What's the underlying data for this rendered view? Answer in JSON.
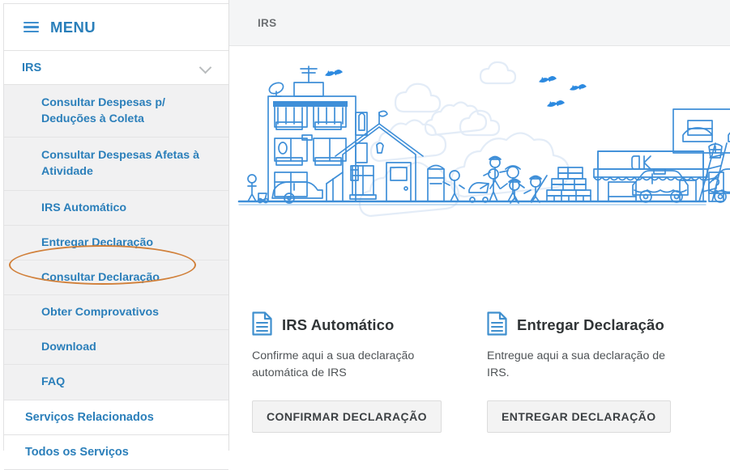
{
  "sidebar": {
    "menu_icon": "hamburger-icon",
    "menu_label": "MENU",
    "group": {
      "label": "IRS",
      "chevron": "chevron-down-icon"
    },
    "submenu": [
      {
        "label": "Consultar Despesas p/ Deduções à Coleta",
        "two_line": true
      },
      {
        "label": "Consultar Despesas Afetas à Atividade",
        "two_line": true
      },
      {
        "label": "IRS Automático",
        "two_line": false
      },
      {
        "label": "Entregar Declaração",
        "two_line": false
      },
      {
        "label": "Consultar Declaração",
        "two_line": false,
        "highlighted": true
      },
      {
        "label": "Obter Comprovativos",
        "two_line": false
      },
      {
        "label": "Download",
        "two_line": false
      },
      {
        "label": "FAQ",
        "two_line": false
      }
    ],
    "bottom_items": [
      {
        "label": "Serviços Relacionados"
      },
      {
        "label": "Todos os Serviços"
      }
    ]
  },
  "header": {
    "breadcrumb": "IRS"
  },
  "hero": {
    "illustration_name": "city-street-line-illustration",
    "line_color": "#3f8fd8",
    "cloud_color": "#e3ecf7"
  },
  "cards": [
    {
      "icon": "document-icon",
      "title": "IRS Automático",
      "description": "Confirme aqui a sua declaração automática de IRS",
      "button_label": "CONFIRMAR DECLARAÇÃO"
    },
    {
      "icon": "document-icon",
      "title": "Entregar Declaração",
      "description": "Entregue aqui a sua declaração de IRS.",
      "button_label": "ENTREGAR DECLARAÇÃO"
    }
  ],
  "annotation": {
    "shape": "ellipse",
    "color": "#d1803a",
    "targets": "Consultar Declaração"
  },
  "colors": {
    "link_blue": "#2b7fba",
    "accent_blue": "#3f8fce",
    "annotation_orange": "#d1803a",
    "submenu_bg": "#f1f1f2",
    "topbar_bg": "#f4f5f6"
  }
}
